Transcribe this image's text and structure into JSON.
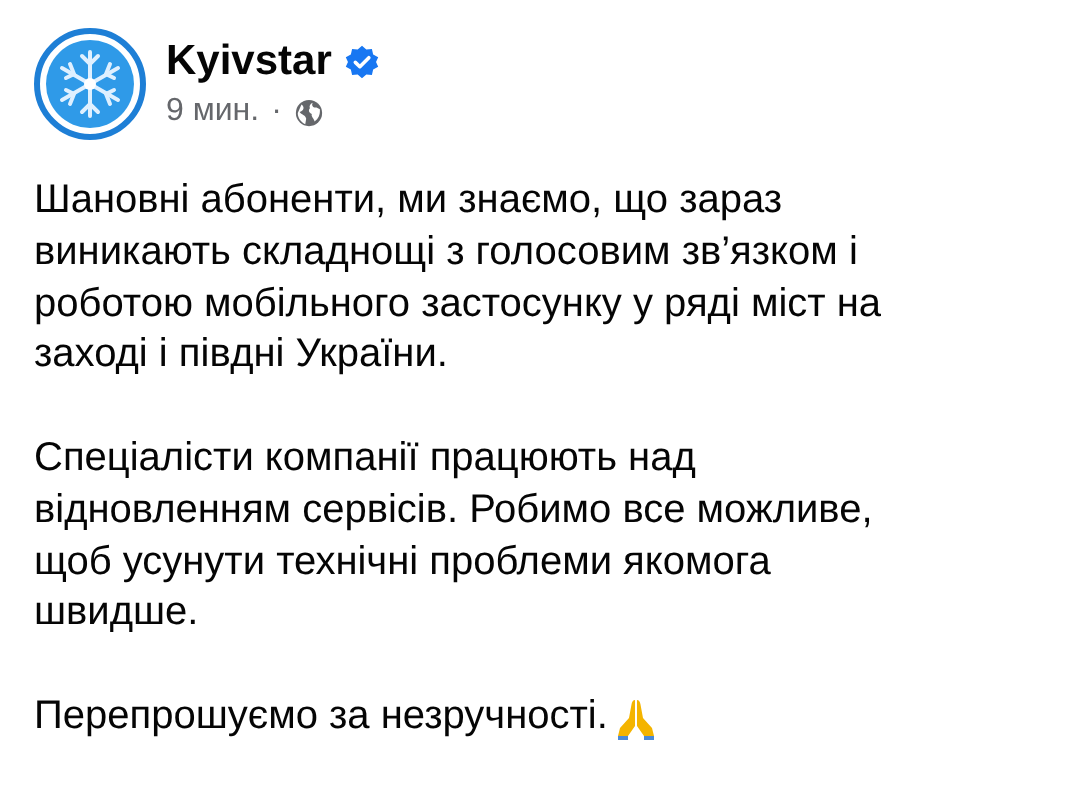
{
  "post": {
    "author": "Kyivstar",
    "verified": true,
    "time": "9 мин.",
    "separator": "·",
    "paragraphs": [
      [
        "Шановні абоненти, ми знаємо, що зараз",
        "виникають складнощі з голосовим зв’язком і",
        "роботою мобільного застосунку у ряді міст на",
        "заході і півдні України."
      ],
      [
        "Спеціалісти компанії працюють над",
        "відновленням сервісів. Робимо все можливе,",
        "щоб усунути технічні проблеми якомога",
        "швидше."
      ],
      [
        "Перепрошуємо за незручності."
      ]
    ]
  }
}
